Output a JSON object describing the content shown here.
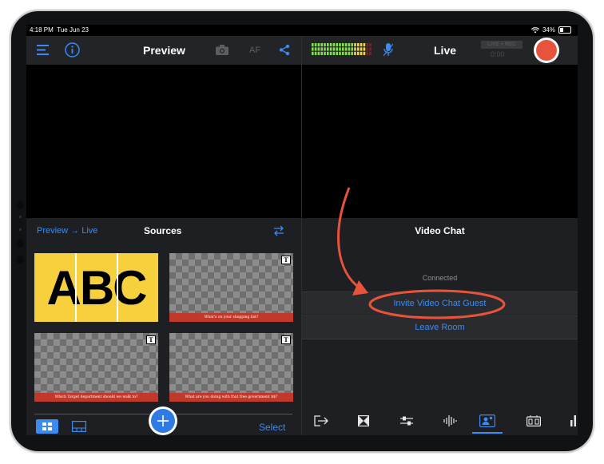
{
  "status_bar": {
    "time": "4:18 PM",
    "date": "Tue Jun 23",
    "battery": "34%"
  },
  "preview_bar": {
    "title": "Preview",
    "af_label": "AF"
  },
  "live_bar": {
    "title": "Live",
    "rec_badge": "LIVE + REC",
    "timer": "0:00",
    "record_color": "#e8533c"
  },
  "sources": {
    "mode_label": "Preview → Live",
    "title": "Sources",
    "select_label": "Select",
    "items": [
      {
        "type": "graphic",
        "text": "ABC"
      },
      {
        "type": "title",
        "caption": "What's on your shopping list?",
        "badge": "T"
      },
      {
        "type": "title",
        "caption": "Which Target department should we walk to?",
        "badge": "T"
      },
      {
        "type": "title",
        "caption": "What are you doing with that free government $$?",
        "badge": "T"
      }
    ]
  },
  "video_chat": {
    "title": "Video Chat",
    "status": "Connected",
    "invite_label": "Invite Video Chat Guest",
    "leave_label": "Leave Room"
  },
  "colors": {
    "accent": "#3b8bf2",
    "annotation": "#e8533c",
    "panel": "#1e1f22"
  }
}
